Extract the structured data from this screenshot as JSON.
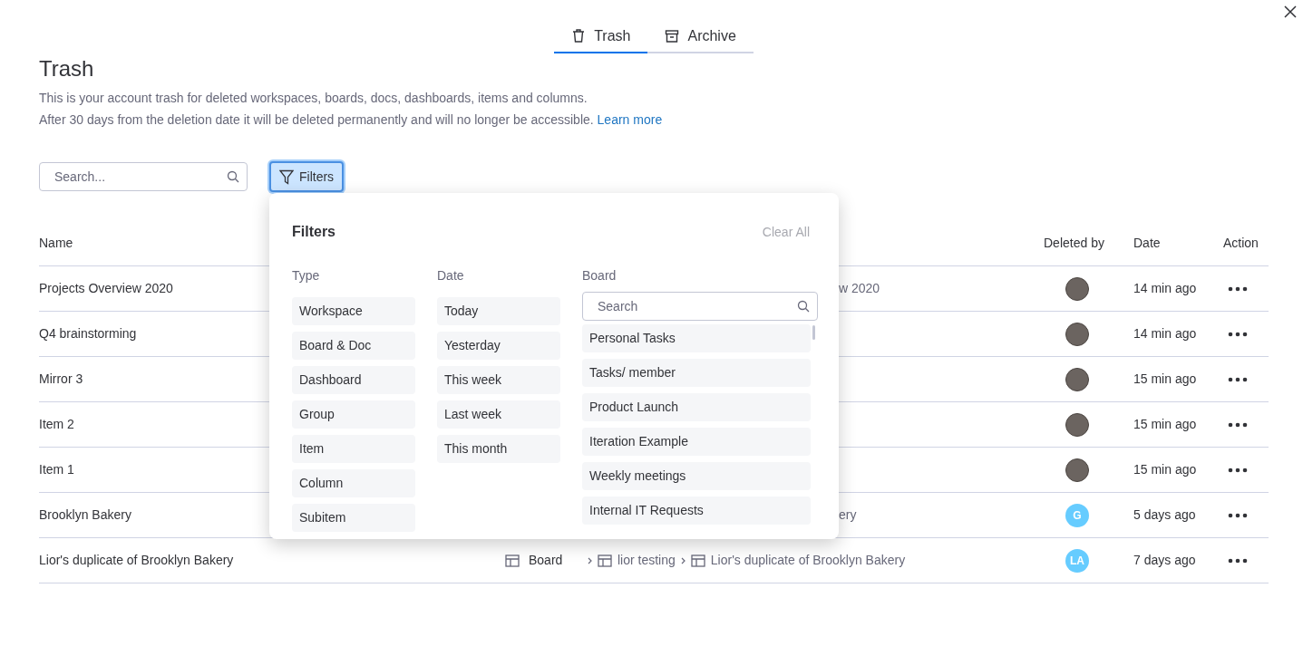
{
  "tabs": [
    {
      "label": "Trash",
      "selected": true
    },
    {
      "label": "Archive",
      "selected": false
    }
  ],
  "title": "Trash",
  "description": [
    "This is your account trash for deleted workspaces, boards, docs, dashboards, items and columns.",
    "After 30 days from the deletion date it will be deleted permanently and will no longer be accessible."
  ],
  "learn_more": "Learn more",
  "search": {
    "placeholder": "Search..."
  },
  "filters_button": {
    "label": "Filters",
    "selected": true
  },
  "table": {
    "columns": [
      "Name",
      "Deleted by",
      "Date",
      "Action"
    ],
    "rows": [
      {
        "name": "Projects Overview 2020",
        "location_fragment": "w 2020",
        "deleted_by": {
          "kind": "photo"
        },
        "date": "14 min ago"
      },
      {
        "name": "Q4 brainstorming",
        "deleted_by": {
          "kind": "photo"
        },
        "date": "14 min ago"
      },
      {
        "name": "Mirror 3",
        "deleted_by": {
          "kind": "photo"
        },
        "date": "15 min ago"
      },
      {
        "name": "Item 2",
        "deleted_by": {
          "kind": "photo"
        },
        "date": "15 min ago"
      },
      {
        "name": "Item 1",
        "deleted_by": {
          "kind": "photo"
        },
        "date": "15 min ago"
      },
      {
        "name": "Brooklyn Bakery",
        "location_fragment": "ery",
        "deleted_by": {
          "kind": "initials",
          "initials": "G",
          "color": "#66ccff"
        },
        "date": "5 days ago"
      },
      {
        "name": "Lior's duplicate of Brooklyn Bakery",
        "type": "Board",
        "path": [
          "lior testing",
          "Lior's duplicate of Brooklyn Bakery"
        ],
        "deleted_by": {
          "kind": "initials",
          "initials": "LA",
          "color": "#66ccff"
        },
        "date": "7 days ago"
      }
    ]
  },
  "filters_panel": {
    "title": "Filters",
    "clear_all": "Clear All",
    "type": {
      "heading": "Type",
      "options": [
        "Workspace",
        "Board & Doc",
        "Dashboard",
        "Group",
        "Item",
        "Column",
        "Subitem"
      ]
    },
    "date": {
      "heading": "Date",
      "options": [
        "Today",
        "Yesterday",
        "This week",
        "Last week",
        "This month"
      ]
    },
    "board": {
      "heading": "Board",
      "search_placeholder": "Search",
      "options": [
        "Personal Tasks",
        "Tasks/ member",
        "Product Launch",
        "Iteration Example",
        "Weekly meetings",
        "Internal IT Requests"
      ]
    }
  }
}
